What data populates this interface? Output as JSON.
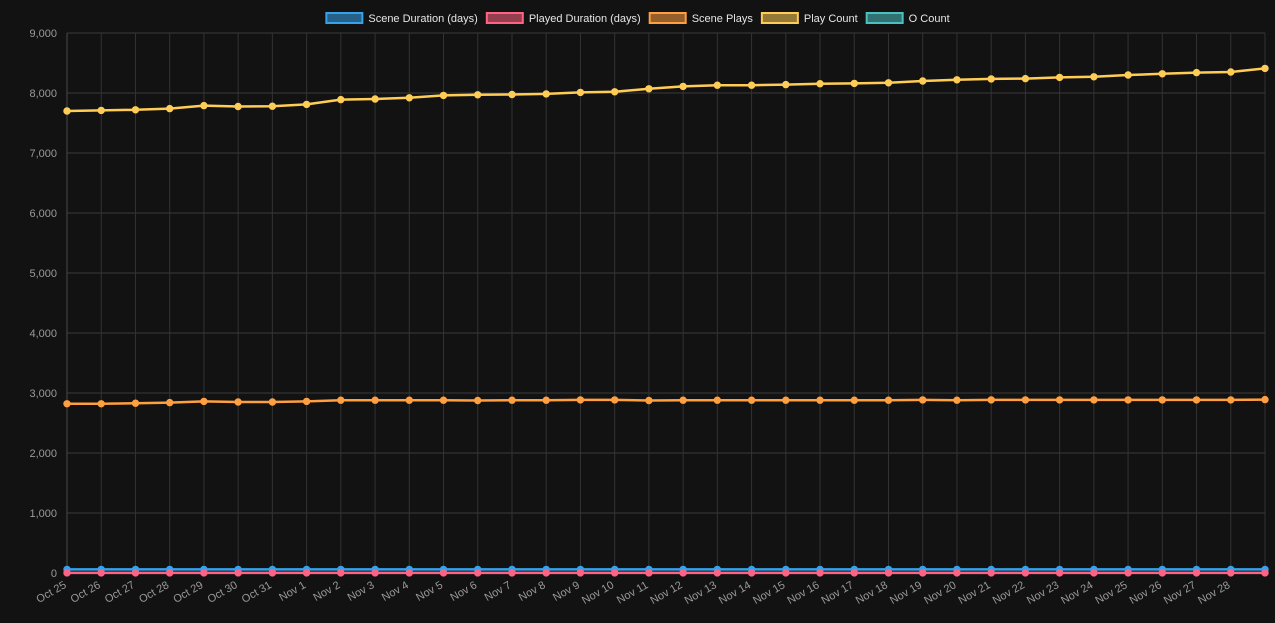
{
  "chart_data": {
    "type": "line",
    "title": "",
    "xlabel": "",
    "ylabel": "",
    "ylim": [
      0,
      9000
    ],
    "yticks": [
      "0",
      "1,000",
      "2,000",
      "3,000",
      "4,000",
      "5,000",
      "6,000",
      "7,000",
      "8,000",
      "9,000"
    ],
    "grid": true,
    "legend_position": "top-center",
    "x_tick_labels": [
      "Oct 25",
      "Oct 26",
      "Oct 27",
      "Oct 28",
      "Oct 29",
      "Oct 30",
      "Oct 31",
      "Nov 1",
      "Nov 2",
      "Nov 3",
      "Nov 4",
      "Nov 5",
      "Nov 6",
      "Nov 7",
      "Nov 8",
      "Nov 9",
      "Nov 10",
      "Nov 11",
      "Nov 12",
      "Nov 13",
      "Nov 14",
      "Nov 15",
      "Nov 16",
      "Nov 17",
      "Nov 18",
      "Nov 19",
      "Nov 20",
      "Nov 21",
      "Nov 22",
      "Nov 23",
      "Nov 24",
      "Nov 25",
      "Nov 26",
      "Nov 27",
      "Nov 28"
    ],
    "x": [
      "2023-10-25",
      "2023-10-26",
      "2023-10-27",
      "2023-10-28",
      "2023-10-29",
      "2023-10-30",
      "2023-10-31",
      "2023-11-01",
      "2023-11-02",
      "2023-11-03",
      "2023-11-04",
      "2023-11-05",
      "2023-11-06",
      "2023-11-07",
      "2023-11-08",
      "2023-11-09",
      "2023-11-10",
      "2023-11-11",
      "2023-11-12",
      "2023-11-13",
      "2023-11-14",
      "2023-11-15",
      "2023-11-16",
      "2023-11-17",
      "2023-11-18",
      "2023-11-19",
      "2023-11-20",
      "2023-11-21",
      "2023-11-22",
      "2023-11-23",
      "2023-11-24",
      "2023-11-25",
      "2023-11-26",
      "2023-11-27",
      "2023-11-28",
      "2023-11-29"
    ],
    "series": [
      {
        "name": "Scene Duration (days)",
        "color": "#36a2eb",
        "values": [
          60,
          60,
          60,
          60,
          60,
          60,
          60,
          60,
          60,
          60,
          60,
          60,
          60,
          60,
          60,
          60,
          60,
          60,
          60,
          60,
          60,
          60,
          60,
          60,
          60,
          60,
          60,
          60,
          60,
          60,
          60,
          60,
          60,
          60,
          60,
          60
        ]
      },
      {
        "name": "Played Duration (days)",
        "color": "#ff6384",
        "values": [
          1,
          1,
          1,
          1,
          1,
          1,
          1,
          1,
          1,
          1,
          1,
          1,
          1,
          1,
          1,
          1,
          1,
          1,
          1,
          1,
          1,
          1,
          1,
          1,
          1,
          1,
          1,
          1,
          1,
          1,
          1,
          1,
          1,
          1,
          1,
          1
        ]
      },
      {
        "name": "Scene Plays",
        "color": "#ff9f40",
        "values": [
          2820,
          2820,
          2830,
          2840,
          2860,
          2850,
          2850,
          2860,
          2880,
          2880,
          2880,
          2880,
          2875,
          2880,
          2880,
          2885,
          2885,
          2875,
          2880,
          2880,
          2880,
          2880,
          2880,
          2880,
          2880,
          2885,
          2880,
          2885,
          2885,
          2885,
          2885,
          2885,
          2885,
          2885,
          2885,
          2890
        ]
      },
      {
        "name": "Play Count",
        "color": "#ffcd56",
        "values": [
          7700,
          7710,
          7720,
          7740,
          7790,
          7775,
          7780,
          7810,
          7890,
          7900,
          7920,
          7960,
          7970,
          7975,
          7985,
          8010,
          8020,
          8070,
          8110,
          8130,
          8130,
          8140,
          8155,
          8160,
          8170,
          8200,
          8220,
          8235,
          8240,
          8260,
          8270,
          8300,
          8320,
          8340,
          8350,
          8410
        ]
      },
      {
        "name": "O Count",
        "color": "#4bc0c0",
        "values": [
          null,
          null,
          null,
          null,
          null,
          null,
          null,
          null,
          null,
          null,
          null,
          null,
          null,
          null,
          null,
          null,
          null,
          null,
          null,
          null,
          null,
          null,
          null,
          null,
          null,
          null,
          null,
          null,
          null,
          null,
          null,
          null,
          null,
          null,
          null,
          null
        ]
      }
    ]
  }
}
